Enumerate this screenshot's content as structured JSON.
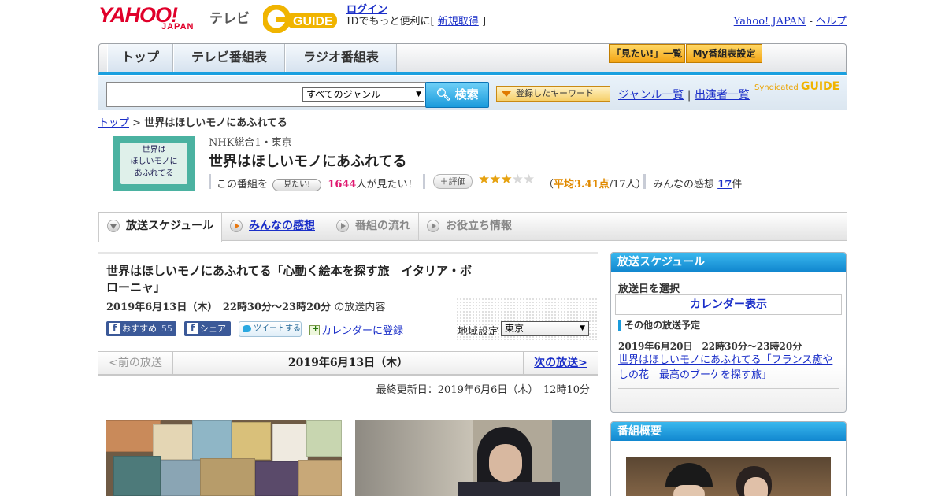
{
  "header": {
    "logo_yahoo": "YAHOO!",
    "logo_japan": "JAPAN",
    "logo_tv": "テレビ",
    "logo_gguide": "GUIDE",
    "login_label": "ログイン",
    "login_prompt_pre": "IDでもっと便利に[",
    "signup_label": "新規取得",
    "login_prompt_post": "]",
    "yahoo_japan_link": "Yahoo! JAPAN",
    "separator": "-",
    "help_link": "ヘルプ"
  },
  "nav": {
    "tabs": [
      "トップ",
      "テレビ番組表",
      "ラジオ番組表"
    ],
    "mitai_list": "「見たい!」一覧",
    "my_bangumi": "My番組表設定"
  },
  "search": {
    "input_value": "",
    "genre_selected": "すべてのジャンル",
    "search_button": "検索",
    "keyword_button": "登録したキーワード",
    "genre_list_link": "ジャンル一覧",
    "link_separator": "|",
    "performer_list_link": "出演者一覧",
    "syndicated": "Syndicated",
    "syndicated_logo": "GUIDE"
  },
  "breadcrumb": {
    "top": "トップ",
    "separator": ">",
    "current": "世界はほしいモノにあふれてる"
  },
  "program": {
    "thumb_lines": [
      "世界は",
      "ほしいモノに",
      "あふれてる"
    ],
    "channel": "NHK総合1・東京",
    "title": "世界はほしいモノにあふれてる",
    "mitai_pre": "この番組を",
    "mitai_badge": "見たい!",
    "mitai_count": "1644",
    "mitai_post": "人が見たい！",
    "hyouka_badge": "評価",
    "stars_on": "★★★",
    "stars_off": "★★",
    "rating_open": "（",
    "rating_avg": "平均3.41点",
    "rating_post": "/17人）",
    "kansou_label": "みんなの感想",
    "kansou_count": "17",
    "kansou_unit": "件"
  },
  "program_tabs": [
    "放送スケジュール",
    "みんなの感想",
    "番組の流れ",
    "お役立ち情報"
  ],
  "episode": {
    "title": "世界はほしいモノにあふれてる「心動く絵本を探す旅　イタリア・ボローニャ」",
    "date": "2019年6月13日（木）　22時30分～23時20分",
    "date_suffix": "の放送内容",
    "fb_recommend": "おすすめ",
    "fb_count": "55",
    "fb_share": "シェア",
    "tweet": "ツイートする",
    "calendar_register": "カレンダーに登録",
    "region_label": "地域設定",
    "region_selected": "東京"
  },
  "pager": {
    "prev": "<前の放送",
    "date": "2019年6月13日（木）",
    "next": "次の放送>"
  },
  "last_updated": "最終更新日：2019年6月6日（木）　12時10分",
  "sidebar": {
    "schedule_head": "放送スケジュール",
    "date_select_label": "放送日を選択",
    "calendar_display": "カレンダー表示",
    "other_label": "その他の放送予定",
    "other_date": "2019年6月20日　22時30分～23時20分",
    "other_title": "世界はほしいモノにあふれてる「フランス癒やしの花　最高のブーケを探す旅」",
    "overview_head": "番組概要"
  },
  "colors": {
    "accent_blue": "#1aa0e0",
    "link": "#1a2ec8",
    "yahoo_red": "#e0002a",
    "mitai_pink": "#e01870",
    "star": "#e6a210"
  }
}
